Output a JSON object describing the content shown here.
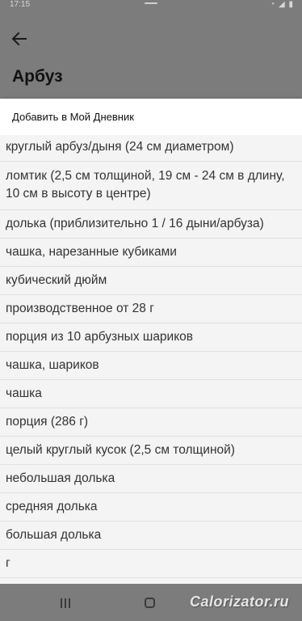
{
  "status_bar": {
    "time": "17:15",
    "icons": "◔ ◢ ▮"
  },
  "header": {
    "back_icon": "arrow-left",
    "title": "Арбуз"
  },
  "sheet": {
    "title": "Добавить в Мой Дневник",
    "options": [
      "круглый арбуз/дыня (24 см диаметром)",
      "ломтик (2,5 см толщиной, 19 см - 24 см в длину, 10 см в высоту в центре)",
      "долька (приблизительно 1 / 16 дыни/арбуза)",
      "чашка, нарезанные кубиками",
      "кубический дюйм",
      "производственное от 28 г",
      "порция из 10 арбузных шариков",
      "чашка, шариков",
      "чашка",
      "порция (286 г)",
      "целый круглый кусок (2,5 см толщиной)",
      "небольшая долька",
      "средняя долька",
      "большая долька",
      "г"
    ]
  },
  "nav": {
    "recent_icon": "recent-apps",
    "home_icon": "home"
  },
  "watermark": "Calorizator.ru",
  "colors": {
    "dim_background": "#7c7c7c",
    "sheet_background": "#f4f4f4",
    "header_background": "#ffffff"
  }
}
